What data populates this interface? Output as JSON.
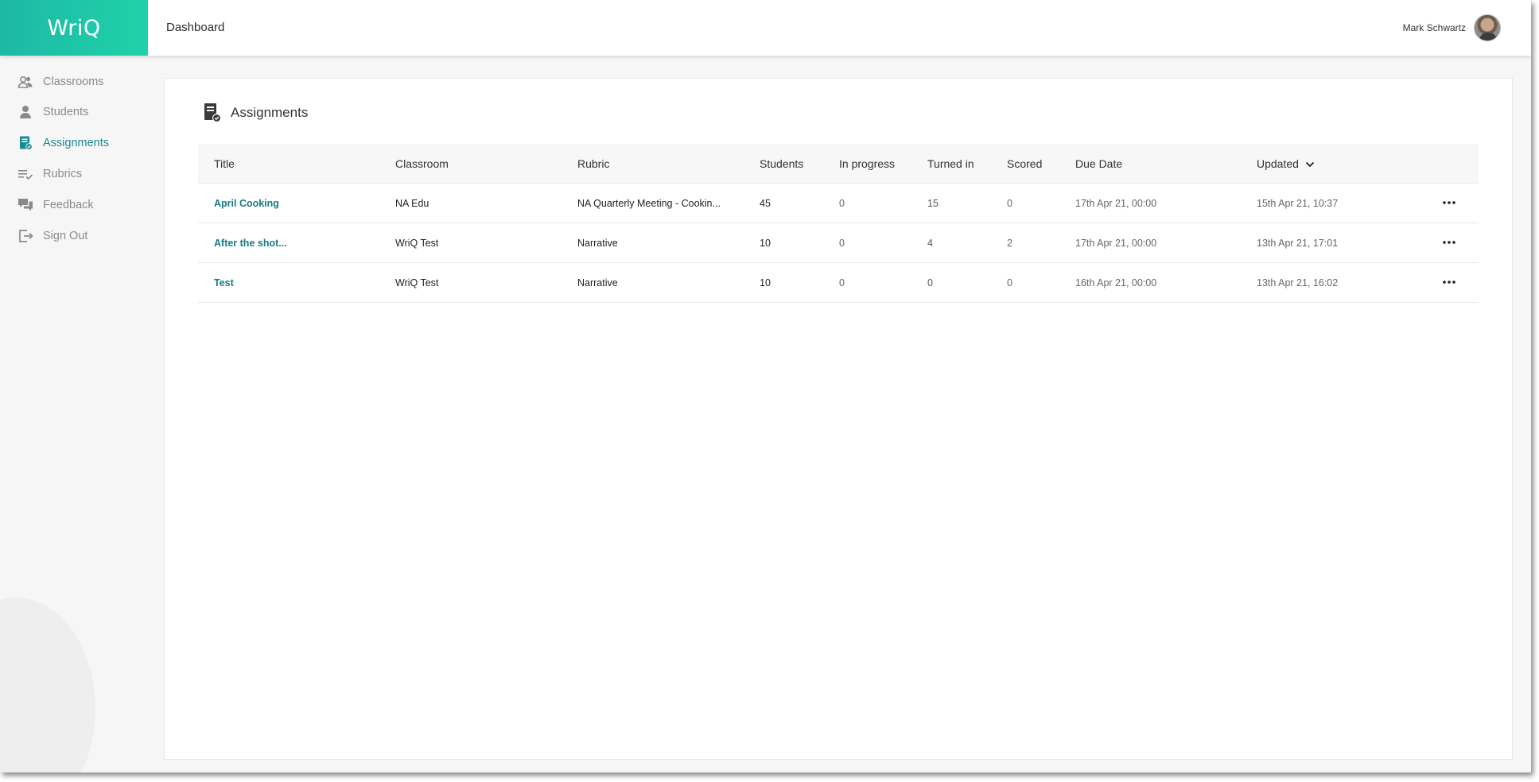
{
  "app": {
    "logo_text": "WriQ",
    "page_title": "Dashboard"
  },
  "user": {
    "name": "Mark Schwartz"
  },
  "sidebar": {
    "items": [
      {
        "label": "Classrooms",
        "icon": "classroom-icon",
        "active": false
      },
      {
        "label": "Students",
        "icon": "student-icon",
        "active": false
      },
      {
        "label": "Assignments",
        "icon": "assignment-icon",
        "active": true
      },
      {
        "label": "Rubrics",
        "icon": "rubric-icon",
        "active": false
      },
      {
        "label": "Feedback",
        "icon": "feedback-icon",
        "active": false
      },
      {
        "label": "Sign Out",
        "icon": "sign-out-icon",
        "active": false
      }
    ]
  },
  "main": {
    "title": "Assignments",
    "columns": [
      "Title",
      "Classroom",
      "Rubric",
      "Students",
      "In progress",
      "Turned in",
      "Scored",
      "Due Date",
      "Updated"
    ],
    "sort_column": "Updated",
    "rows": [
      {
        "title": "April Cooking",
        "classroom": "NA Edu",
        "rubric": "NA Quarterly Meeting - Cookin...",
        "students": "45",
        "in_progress": "0",
        "turned_in": "15",
        "scored": "0",
        "due_date": "17th Apr 21, 00:00",
        "updated": "15th Apr 21, 10:37"
      },
      {
        "title": "After the shot...",
        "classroom": "WriQ Test",
        "rubric": "Narrative",
        "students": "10",
        "in_progress": "0",
        "turned_in": "4",
        "scored": "2",
        "due_date": "17th Apr 21, 00:00",
        "updated": "13th Apr 21, 17:01"
      },
      {
        "title": "Test",
        "classroom": "WriQ Test",
        "rubric": "Narrative",
        "students": "10",
        "in_progress": "0",
        "turned_in": "0",
        "scored": "0",
        "due_date": "16th Apr 21, 00:00",
        "updated": "13th Apr 21, 16:02"
      }
    ]
  },
  "colors": {
    "brand_start": "#1db8a6",
    "brand_end": "#1fd2a9",
    "accent": "#1a8a93",
    "link": "#187a83"
  }
}
